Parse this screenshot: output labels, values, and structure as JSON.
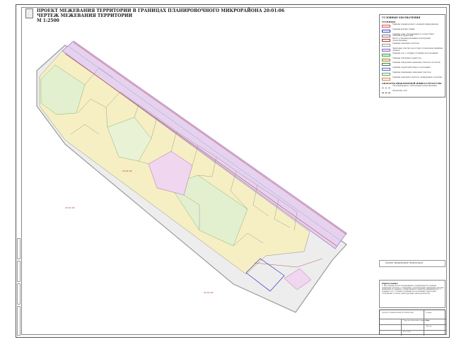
{
  "header": {
    "title_line1": "ПРОЕКТ МЕЖЕВАНИЯ ТЕРРИТОРИИ В ГРАНИЦАХ ПЛАНИРОВОЧНОГО МИКРОРАЙОНА 20:01:06",
    "title_line2": "ЧЕРТЕЖ МЕЖЕВАНИЯ ТЕРРИТОРИИ",
    "title_line3": "М 1:2500"
  },
  "legend": {
    "title": "УСЛОВНЫЕ ОБОЗНАЧЕНИЯ",
    "section_borders": "ГРАНИЦЫ",
    "section_infra": "ОБЪЕКТЫ ИНЖЕНЕРНОЙ ИНФРАСТРУКТУРЫ",
    "items": [
      {
        "label": "Границы планировочного элемента (микрорайона)",
        "color": "#e05a5a",
        "fill": "#fde8e8"
      },
      {
        "label": "Границы красных линий",
        "color": "#3a3ad0",
        "fill": "#ffffff"
      },
      {
        "label": "Границы зоны, обозначенные в соответствии с генпланом территории",
        "color": "#777777",
        "fill": "#ffffff"
      },
      {
        "label": "Места установки рекламных конструкций (существующие)",
        "color": "#b0352a",
        "fill": "#ffffff"
      },
      {
        "label": "Границы земельных участков",
        "color": "#999999",
        "fill": "#ffffff"
      },
      {
        "label": "Земельные участки, на которых установлены линейные объекты",
        "color": "#8e6bbd",
        "fill": "#efe2f6"
      },
      {
        "label": "Границы зон с особыми условиями использования",
        "color": "#3aa05a",
        "fill": "#e5f3d9"
      },
      {
        "label": "Границы публичных сервитутов",
        "color": "#9a8d3c",
        "fill": "#f6f1cf"
      },
      {
        "label": "Границы образуемых земельных участков, их частей",
        "color": "#3a7a3a",
        "fill": "#ffffff"
      },
      {
        "label": "Границы территорий общего пользования",
        "color": "#5b5bd0",
        "fill": "#ffffff"
      },
      {
        "label": "Границы изменяемых земельных участков",
        "color": "#5aa55a",
        "fill": "#ffffff"
      },
      {
        "label": "Границы земельных участков, планируемых к изъятию",
        "color": "#cc8844",
        "fill": "#ffffff"
      }
    ],
    "infra_items": [
      {
        "label": "Сети инженерного обеспечения (существующие)",
        "color": "#888888"
      },
      {
        "label": "Проектные сети",
        "color": "#555555"
      }
    ]
  },
  "map_labels": {
    "zone_a": "20:01:06",
    "zone_b": "20:01:06",
    "zone_c": "20:01:06"
  },
  "notes": {
    "title": "Примечания",
    "text": "1. Настоящим проектом межевания устанавливаются границы земельных участков. 2. Сведения о существующих земельных участках приведены по данным государственного кадастра недвижимости. 3. Границы зон с особыми условиями использования территорий отображены согласно действующему законодательству."
  },
  "stamp": {
    "title": "ПРОЕКТ МЕЖЕВАНИЯ ТЕРРИТОРИИ",
    "sheet": "Чертеж межевания территории",
    "stage": "Стадия",
    "sheet_label": "Лист",
    "sheets_label": "Листов",
    "scale": "М 1:2500"
  },
  "colors": {
    "corridor_fill": "#e4d2ef",
    "corridor_edge": "#a27fc6",
    "parcel_fill": "#f6efc3",
    "green_fill": "#e3f0cf",
    "road_fill": "#e8e8e8",
    "boundary_red": "#d24a4a",
    "boundary_blue": "#3a3ad0"
  }
}
